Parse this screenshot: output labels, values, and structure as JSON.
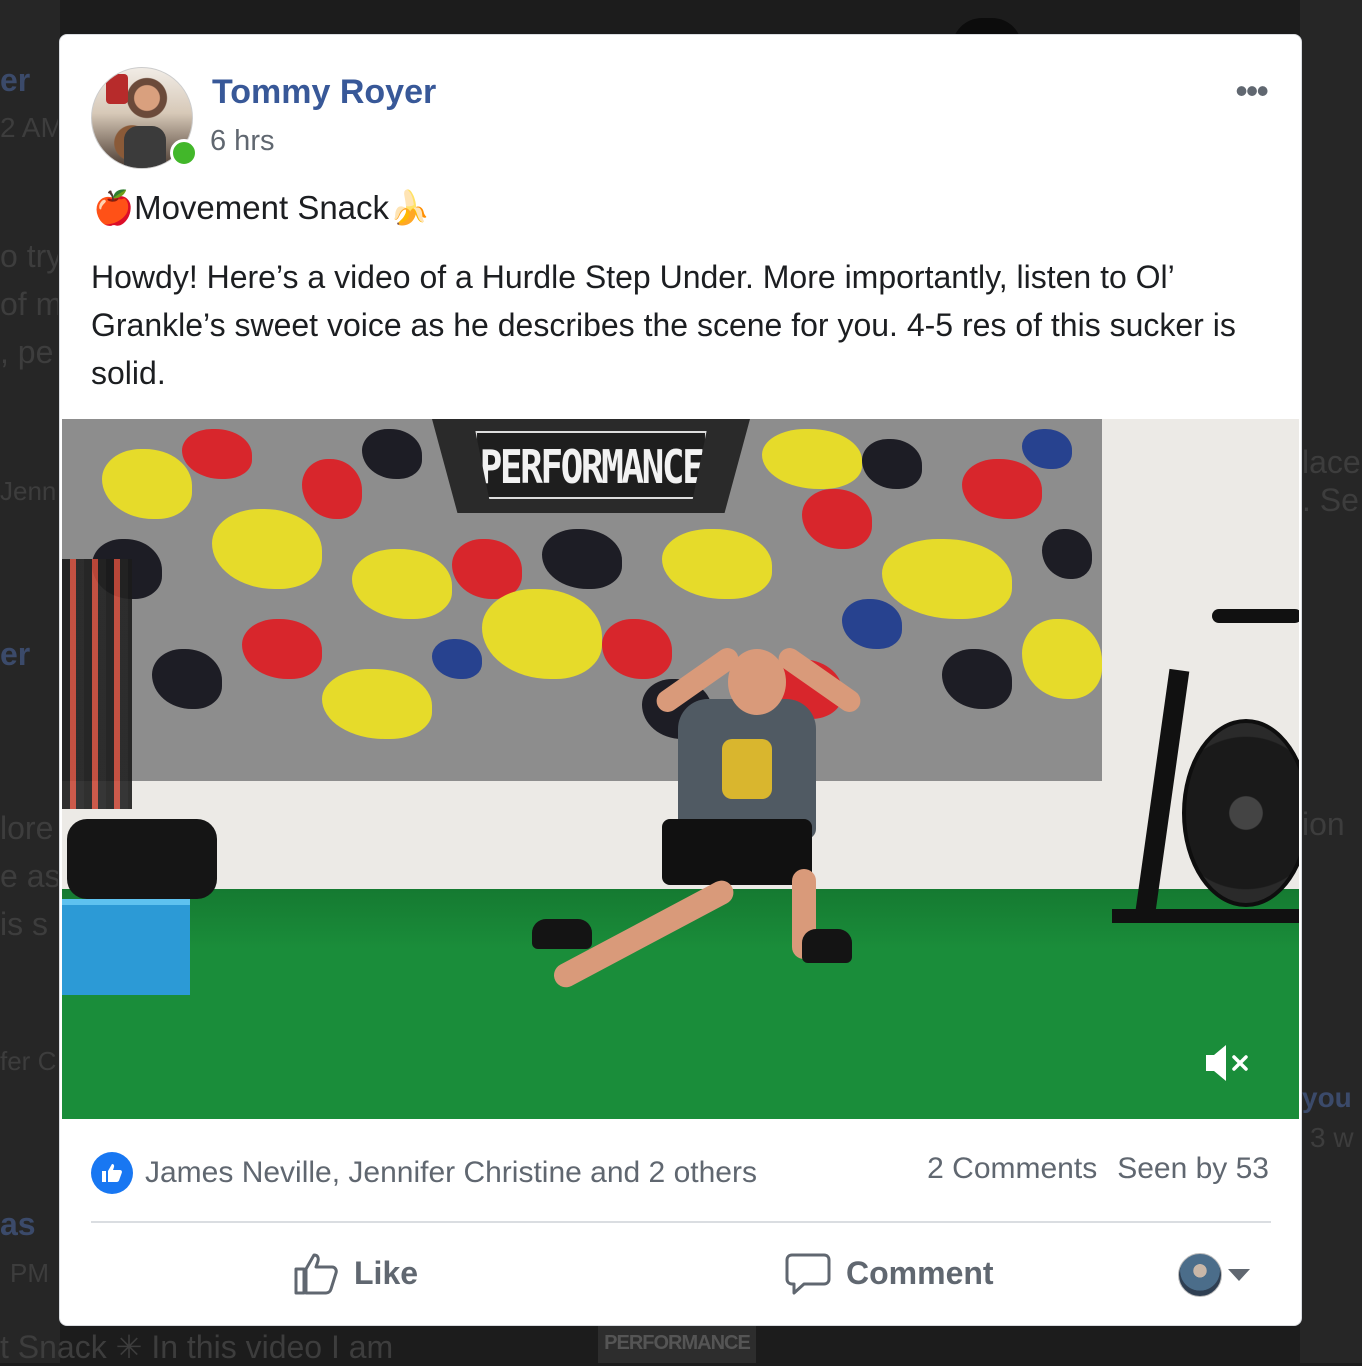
{
  "background_feed": {
    "fragments_left": [
      "er",
      "2 AM",
      "o try",
      "of m",
      ", pe",
      "Jenn",
      "er",
      "lore",
      "e as",
      "is s",
      "fer C",
      "as",
      "PM"
    ],
    "fragments_right": [
      "lace",
      ". Se",
      "ion",
      "you",
      "3 w"
    ],
    "bottom_text": "t Snack ✳ In this video I am",
    "bottom_thumb_label": "PERFORMANCE"
  },
  "post": {
    "author": "Tommy Royer",
    "time": "6 hrs",
    "more_label": "•••",
    "title_emoji_start": "🍎",
    "title": "Movement Snack",
    "title_emoji_end": "🍌",
    "body": "Howdy! Here’s a video of a Hurdle Step Under. More importantly, listen to Ol’ Grankle’s sweet voice as he describes the scene for you. 4-5 res of this sucker is solid.",
    "video": {
      "wall_sign": "PERFORMANCE",
      "muted_icon": "mute-icon"
    },
    "reactions_text": "James Neville, Jennifer Christine and 2 others",
    "comments_count": "2 Comments",
    "seen_by": "Seen by 53",
    "actions": {
      "like_label": "Like",
      "comment_label": "Comment"
    }
  },
  "colors": {
    "name_blue": "#385898",
    "like_blue": "#1877f2",
    "online_green": "#42b72a",
    "turf_green": "#1a8d3a"
  }
}
